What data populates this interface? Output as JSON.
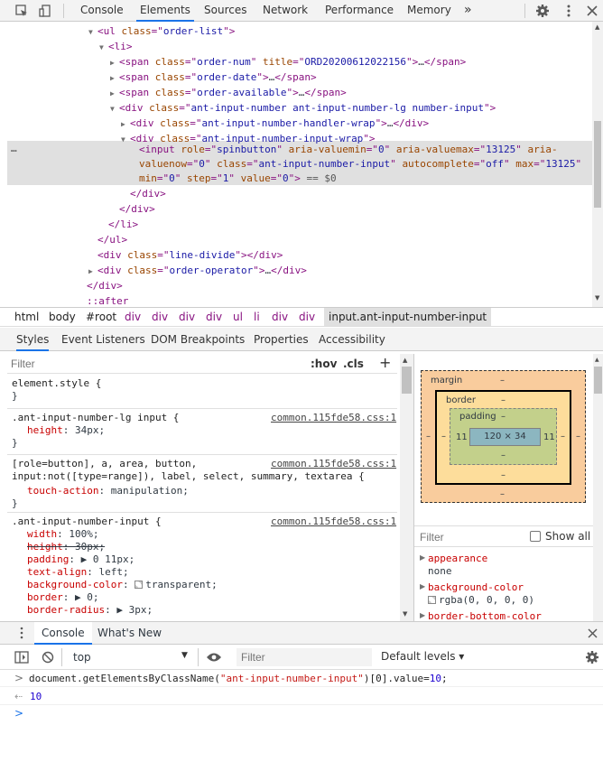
{
  "toolbar": {
    "tabs": [
      "Console",
      "Elements",
      "Sources",
      "Network",
      "Performance",
      "Memory"
    ],
    "selected_tab": "Elements",
    "more": "»"
  },
  "tree": {
    "lines": [
      {
        "indent": 110,
        "arrow": "▼",
        "html": [
          [
            "tag",
            "<ul "
          ],
          [
            "attr",
            "class"
          ],
          [
            "tag",
            "=\""
          ],
          [
            "val",
            "order-list"
          ],
          [
            "tag",
            "\">"
          ]
        ]
      },
      {
        "indent": 122,
        "arrow": "▼",
        "html": [
          [
            "tag",
            "<li>"
          ]
        ]
      },
      {
        "indent": 134,
        "arrow": "▶",
        "html": [
          [
            "tag",
            "<span "
          ],
          [
            "attr",
            "class"
          ],
          [
            "tag",
            "=\""
          ],
          [
            "val",
            "order-num"
          ],
          [
            "tag",
            "\" "
          ],
          [
            "attr",
            "title"
          ],
          [
            "tag",
            "=\""
          ],
          [
            "val",
            "ORD20200612022156"
          ],
          [
            "tag",
            "\">"
          ],
          [
            "txt",
            "…"
          ],
          [
            "tag",
            "</span>"
          ]
        ]
      },
      {
        "indent": 134,
        "arrow": "▶",
        "html": [
          [
            "tag",
            "<span "
          ],
          [
            "attr",
            "class"
          ],
          [
            "tag",
            "=\""
          ],
          [
            "val",
            "order-date"
          ],
          [
            "tag",
            "\">"
          ],
          [
            "txt",
            "…"
          ],
          [
            "tag",
            "</span>"
          ]
        ]
      },
      {
        "indent": 134,
        "arrow": "▶",
        "html": [
          [
            "tag",
            "<span "
          ],
          [
            "attr",
            "class"
          ],
          [
            "tag",
            "=\""
          ],
          [
            "val",
            "order-available"
          ],
          [
            "tag",
            "\">"
          ],
          [
            "txt",
            "…"
          ],
          [
            "tag",
            "</span>"
          ]
        ]
      },
      {
        "indent": 134,
        "arrow": "▼",
        "html": [
          [
            "tag",
            "<div "
          ],
          [
            "attr",
            "class"
          ],
          [
            "tag",
            "=\""
          ],
          [
            "val",
            "ant-input-number ant-input-number-lg number-input"
          ],
          [
            "tag",
            "\">"
          ]
        ]
      },
      {
        "indent": 146,
        "arrow": "▶",
        "html": [
          [
            "tag",
            "<div "
          ],
          [
            "attr",
            "class"
          ],
          [
            "tag",
            "=\""
          ],
          [
            "val",
            "ant-input-number-handler-wrap"
          ],
          [
            "tag",
            "\">"
          ],
          [
            "txt",
            "…"
          ],
          [
            "tag",
            "</div>"
          ]
        ]
      },
      {
        "indent": 146,
        "arrow": "▼",
        "html": [
          [
            "tag",
            "<div "
          ],
          [
            "attr",
            "class"
          ],
          [
            "tag",
            "=\""
          ],
          [
            "val",
            "ant-input-number-input-wrap"
          ],
          [
            "tag",
            "\">"
          ]
        ]
      }
    ],
    "selected_lines": [
      [
        [
          "tag",
          "<input "
        ],
        [
          "attr",
          "role"
        ],
        [
          "tag",
          "=\""
        ],
        [
          "val",
          "spinbutton"
        ],
        [
          "tag",
          "\" "
        ],
        [
          "attr",
          "aria-valuemin"
        ],
        [
          "tag",
          "=\""
        ],
        [
          "val",
          "0"
        ],
        [
          "tag",
          "\" "
        ],
        [
          "attr",
          "aria-valuemax"
        ],
        [
          "tag",
          "=\""
        ],
        [
          "val",
          "13125"
        ],
        [
          "tag",
          "\" "
        ],
        [
          "attr",
          "aria-"
        ]
      ],
      [
        [
          "attr",
          "valuenow"
        ],
        [
          "tag",
          "=\""
        ],
        [
          "val",
          "0"
        ],
        [
          "tag",
          "\" "
        ],
        [
          "attr",
          "class"
        ],
        [
          "tag",
          "=\""
        ],
        [
          "val",
          "ant-input-number-input"
        ],
        [
          "tag",
          "\" "
        ],
        [
          "attr",
          "autocomplete"
        ],
        [
          "tag",
          "=\""
        ],
        [
          "val",
          "off"
        ],
        [
          "tag",
          "\" "
        ],
        [
          "attr",
          "max"
        ],
        [
          "tag",
          "=\""
        ],
        [
          "val",
          "13125"
        ],
        [
          "tag",
          "\""
        ]
      ],
      [
        [
          "attr",
          "min"
        ],
        [
          "tag",
          "=\""
        ],
        [
          "val",
          "0"
        ],
        [
          "tag",
          "\" "
        ],
        [
          "attr",
          "step"
        ],
        [
          "tag",
          "=\""
        ],
        [
          "val",
          "1"
        ],
        [
          "tag",
          "\" "
        ],
        [
          "attr",
          "value"
        ],
        [
          "tag",
          "=\""
        ],
        [
          "val",
          "0"
        ],
        [
          "tag",
          "\">"
        ],
        [
          "cmt",
          " == $0"
        ]
      ]
    ],
    "after_lines": [
      {
        "indent": 146,
        "arrow": "",
        "html": [
          [
            "tag",
            "</div>"
          ]
        ]
      },
      {
        "indent": 134,
        "arrow": "",
        "html": [
          [
            "tag",
            "</div>"
          ]
        ]
      },
      {
        "indent": 122,
        "arrow": "",
        "html": [
          [
            "tag",
            "</li>"
          ]
        ]
      },
      {
        "indent": 110,
        "arrow": "",
        "html": [
          [
            "tag",
            "</ul>"
          ]
        ]
      },
      {
        "indent": 110,
        "arrow": "",
        "html": [
          [
            "tag",
            "<div "
          ],
          [
            "attr",
            "class"
          ],
          [
            "tag",
            "=\""
          ],
          [
            "val",
            "line-divide"
          ],
          [
            "tag",
            "\"></div>"
          ]
        ]
      },
      {
        "indent": 110,
        "arrow": "▶",
        "html": [
          [
            "tag",
            "<div "
          ],
          [
            "attr",
            "class"
          ],
          [
            "tag",
            "=\""
          ],
          [
            "val",
            "order-operator"
          ],
          [
            "tag",
            "\">"
          ],
          [
            "txt",
            "…"
          ],
          [
            "tag",
            "</div>"
          ]
        ]
      },
      {
        "indent": 98,
        "arrow": "",
        "html": [
          [
            "tag",
            "</div>"
          ]
        ]
      },
      {
        "indent": 98,
        "arrow": "",
        "html": [
          [
            "tag",
            "::after"
          ]
        ]
      }
    ],
    "ellipsis": "…"
  },
  "breadcrumbs": [
    "html",
    "body",
    "#root",
    "div",
    "div",
    "div",
    "div",
    "ul",
    "li",
    "div",
    "div",
    "input.ant-input-number-input"
  ],
  "subtabs": [
    "Styles",
    "Event Listeners",
    "DOM Breakpoints",
    "Properties",
    "Accessibility"
  ],
  "styles": {
    "filter_placeholder": "Filter",
    "hov": ":hov",
    "cls": ".cls",
    "plus": "+",
    "rules": [
      {
        "selector": "element.style {",
        "source": "",
        "decls": [],
        "close": "}"
      },
      {
        "selector": ".ant-input-number-lg input {",
        "source": "common.115fde58.css:1",
        "decls": [
          {
            "p": "height",
            "v": "34px;",
            "struck": false
          }
        ],
        "close": "}"
      },
      {
        "selector": "[role=button], a, area, button,",
        "selector2": "input:not([type=range]), label, select, summary, textarea {",
        "source": "common.115fde58.css:1",
        "decls": [
          {
            "p": "touch-action",
            "v": "manipulation;",
            "struck": false
          }
        ],
        "close": "}"
      },
      {
        "selector": ".ant-input-number-input {",
        "source": "common.115fde58.css:1",
        "decls": [
          {
            "p": "width",
            "v": "100%;",
            "struck": false
          },
          {
            "p": "height",
            "v": "30px;",
            "struck": true
          },
          {
            "p": "padding",
            "v": "▶ 0 11px;",
            "struck": false
          },
          {
            "p": "text-align",
            "v": "left;",
            "struck": false
          },
          {
            "p": "background-color",
            "v": "transparent;",
            "struck": false,
            "swatch": true
          },
          {
            "p": "border",
            "v": "▶ 0;",
            "struck": false
          },
          {
            "p": "border-radius",
            "v": "▶ 3px;",
            "struck": false
          }
        ]
      }
    ]
  },
  "boxmodel": {
    "margin_label": "margin",
    "border_label": "border",
    "padding_label": "padding",
    "dash": "–",
    "content": "120 × 34",
    "pad_left": "11",
    "pad_right": "11"
  },
  "computed": {
    "filter_placeholder": "Filter",
    "show_all": "Show all",
    "props": [
      {
        "name": "appearance",
        "value": "none"
      },
      {
        "name": "background-color",
        "value": "rgba(0, 0, 0, 0)",
        "swatch": true
      },
      {
        "name": "border-bottom-color",
        "value": ""
      }
    ]
  },
  "console": {
    "tabs": [
      "Console",
      "What's New"
    ],
    "context": "top",
    "filter_placeholder": "Filter",
    "levels": "Default levels ▾",
    "input_line": {
      "prefix": "document.getElementsByClassName(",
      "str": "\"ant-input-number-input\"",
      "suffix": ")[0].value=",
      "num": "10",
      "end": ";"
    },
    "result": "10"
  }
}
